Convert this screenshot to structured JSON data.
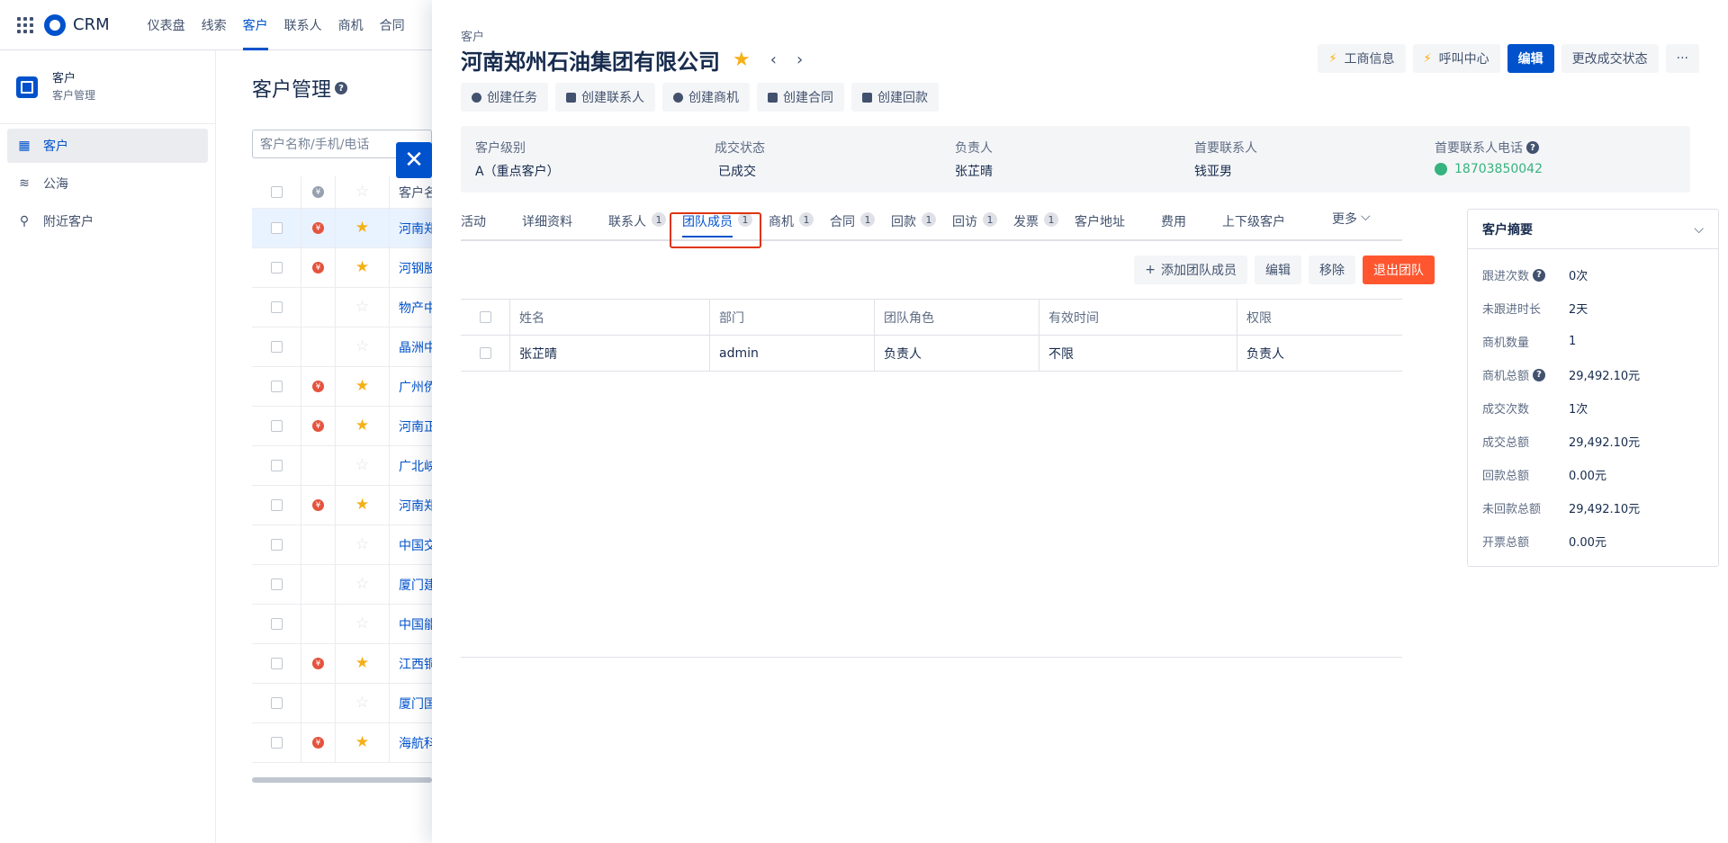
{
  "app": {
    "name": "CRM"
  },
  "nav": {
    "items": [
      "仪表盘",
      "线索",
      "客户",
      "联系人",
      "商机",
      "合同"
    ],
    "active_index": 2
  },
  "sidebar": {
    "module_title": "客户",
    "module_subtitle": "客户管理",
    "items": [
      {
        "label": "客户",
        "icon": "building-icon",
        "active": true
      },
      {
        "label": "公海",
        "icon": "waves-icon",
        "active": false
      },
      {
        "label": "附近客户",
        "icon": "location-pin-icon",
        "active": false
      }
    ]
  },
  "list": {
    "page_title": "客户管理",
    "search_placeholder": "客户名称/手机/电话",
    "column_name_header": "客户名",
    "rows": [
      {
        "name": "河南郑",
        "coin": true,
        "star": true,
        "selected": true
      },
      {
        "name": "河钢股",
        "coin": true,
        "star": true
      },
      {
        "name": "物产中",
        "coin": false,
        "star": false
      },
      {
        "name": "晶洲中",
        "coin": false,
        "star": false
      },
      {
        "name": "广州侨",
        "coin": true,
        "star": true
      },
      {
        "name": "河南正",
        "coin": true,
        "star": true
      },
      {
        "name": "广北峡",
        "coin": false,
        "star": false
      },
      {
        "name": "河南郑",
        "coin": true,
        "star": true
      },
      {
        "name": "中国交",
        "coin": false,
        "star": false
      },
      {
        "name": "厦门建",
        "coin": false,
        "star": false
      },
      {
        "name": "中国能",
        "coin": false,
        "star": false
      },
      {
        "name": "江西铜",
        "coin": true,
        "star": true
      },
      {
        "name": "厦门国",
        "coin": false,
        "star": false
      },
      {
        "name": "海航科",
        "coin": true,
        "star": true
      }
    ]
  },
  "drawer": {
    "breadcrumb": "客户",
    "title": "河南郑州石油集团有限公司",
    "header_actions": {
      "business_info": "工商信息",
      "call_center": "呼叫中心",
      "edit": "编辑",
      "change_deal_status": "更改成交状态",
      "more": "···"
    },
    "quick_actions": [
      "创建任务",
      "创建联系人",
      "创建商机",
      "创建合同",
      "创建回款"
    ],
    "summary": [
      {
        "label": "客户级别",
        "value": "A（重点客户）"
      },
      {
        "label": "成交状态",
        "value": "已成交"
      },
      {
        "label": "负责人",
        "value": "张芷晴"
      },
      {
        "label": "首要联系人",
        "value": "钱亚男"
      },
      {
        "label": "首要联系人电话",
        "value": "18703850042"
      }
    ],
    "tabs": [
      {
        "label": "活动",
        "badge": null
      },
      {
        "label": "详细资料",
        "badge": null
      },
      {
        "label": "联系人",
        "badge": "1"
      },
      {
        "label": "团队成员",
        "badge": "1",
        "active": true
      },
      {
        "label": "商机",
        "badge": "1"
      },
      {
        "label": "合同",
        "badge": "1"
      },
      {
        "label": "回款",
        "badge": "1"
      },
      {
        "label": "回访",
        "badge": "1"
      },
      {
        "label": "发票",
        "badge": "1"
      },
      {
        "label": "客户地址",
        "badge": null
      },
      {
        "label": "费用",
        "badge": null
      },
      {
        "label": "上下级客户",
        "badge": null
      },
      {
        "label": "更多",
        "badge": null
      }
    ],
    "team_actions": {
      "add_member": "添加团队成员",
      "edit": "编辑",
      "remove": "移除",
      "exit_team": "退出团队"
    },
    "member_table": {
      "headers": [
        "姓名",
        "部门",
        "团队角色",
        "有效时间",
        "权限"
      ],
      "rows": [
        [
          "张芷晴",
          "admin",
          "负责人",
          "不限",
          "负责人"
        ]
      ]
    },
    "summary_card": {
      "title": "客户摘要",
      "rows": [
        {
          "label": "跟进次数",
          "value": "0次",
          "help": true
        },
        {
          "label": "未跟进时长",
          "value": "2天",
          "help": false
        },
        {
          "label": "商机数量",
          "value": "1",
          "help": false
        },
        {
          "label": "商机总额",
          "value": "29,492.10元",
          "help": true
        },
        {
          "label": "成交次数",
          "value": "1次",
          "help": false
        },
        {
          "label": "成交总额",
          "value": "29,492.10元",
          "help": false
        },
        {
          "label": "回款总额",
          "value": "0.00元",
          "help": false
        },
        {
          "label": "未回款总额",
          "value": "29,492.10元",
          "help": false
        },
        {
          "label": "开票总额",
          "value": "0.00元",
          "help": false
        }
      ]
    }
  },
  "colors": {
    "primary": "#0052cc",
    "danger": "#ff5630",
    "star": "#f5b017",
    "phone": "#36b37e",
    "highlight_border": "#de350b"
  }
}
